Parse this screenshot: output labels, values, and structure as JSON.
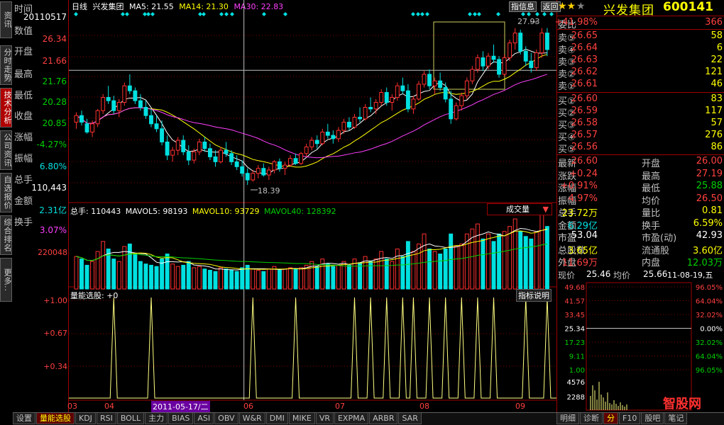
{
  "left_tabs": [
    "资讯",
    "分时走势",
    "技术分析",
    "公司资讯",
    "自选报价",
    "综合排名",
    "更多.."
  ],
  "left_tabs_active": 2,
  "info_column": {
    "labels": [
      "时间",
      "数值",
      "开盘",
      "最高",
      "最低",
      "收盘",
      "涨幅",
      "振幅",
      "总手",
      "金额",
      "换手"
    ],
    "time": "20110517",
    "value": "26.34",
    "open": "21.66",
    "high": "21.76",
    "low": "20.28",
    "close": "20.85",
    "change": "-4.27%",
    "amplitude": "6.80%",
    "volume": "110,443",
    "amount": "2.31亿",
    "turnover": "3.07%"
  },
  "header": {
    "period": "日线",
    "name": "兴发集团",
    "ma5": "MA5: 21.55",
    "ma14": "MA14: 21.30",
    "ma30": "MA30: 22.83",
    "btn_info": "信息",
    "btn_info_icon_label": "指",
    "btn_back": "返回"
  },
  "price_chart": {
    "ymin": 17.5,
    "ymax": 29.0,
    "high_label": "27.93",
    "low_label": "18.39",
    "ref_price": 25.34,
    "candles": [
      [
        22.2,
        22.8,
        21.8,
        22.6
      ],
      [
        22.6,
        22.9,
        22.0,
        22.2
      ],
      [
        22.1,
        22.4,
        21.5,
        21.6
      ],
      [
        21.6,
        22.3,
        21.3,
        22.1
      ],
      [
        22.1,
        23.0,
        21.9,
        22.9
      ],
      [
        22.9,
        23.9,
        22.7,
        23.7
      ],
      [
        23.7,
        24.4,
        23.3,
        23.5
      ],
      [
        23.5,
        23.8,
        22.7,
        22.9
      ],
      [
        22.9,
        23.6,
        22.5,
        23.4
      ],
      [
        23.4,
        24.6,
        23.2,
        24.4
      ],
      [
        24.4,
        25.1,
        23.9,
        24.1
      ],
      [
        24.1,
        24.3,
        23.3,
        23.5
      ],
      [
        23.5,
        23.9,
        22.9,
        23.1
      ],
      [
        23.1,
        23.5,
        22.4,
        22.6
      ],
      [
        22.6,
        23.0,
        21.9,
        22.1
      ],
      [
        22.1,
        22.6,
        21.6,
        21.8
      ],
      [
        21.8,
        22.3,
        20.8,
        21.0
      ],
      [
        21.0,
        21.4,
        19.9,
        20.2
      ],
      [
        20.2,
        20.7,
        19.8,
        20.5
      ],
      [
        20.5,
        21.3,
        20.2,
        21.1
      ],
      [
        21.1,
        21.4,
        20.2,
        20.4
      ],
      [
        20.4,
        20.8,
        19.6,
        19.9
      ],
      [
        19.9,
        20.6,
        19.7,
        20.4
      ],
      [
        20.4,
        21.2,
        20.2,
        21.0
      ],
      [
        21.0,
        21.3,
        20.4,
        20.6
      ],
      [
        20.6,
        20.9,
        19.9,
        20.1
      ],
      [
        20.1,
        20.5,
        19.5,
        19.8
      ],
      [
        19.8,
        20.7,
        19.7,
        20.5
      ],
      [
        20.5,
        21.0,
        20.1,
        20.3
      ],
      [
        20.3,
        20.5,
        19.6,
        19.8
      ],
      [
        19.8,
        20.2,
        19.3,
        19.5
      ],
      [
        19.5,
        19.9,
        18.9,
        19.1
      ],
      [
        19.1,
        19.4,
        18.4,
        18.7
      ],
      [
        18.7,
        19.3,
        18.6,
        19.1
      ],
      [
        19.1,
        19.6,
        18.8,
        19.4
      ],
      [
        19.4,
        19.7,
        18.9,
        19.0
      ],
      [
        19.0,
        19.5,
        18.7,
        19.3
      ],
      [
        19.3,
        19.9,
        19.1,
        19.8
      ],
      [
        19.8,
        20.0,
        19.2,
        19.4
      ],
      [
        19.4,
        19.8,
        19.0,
        19.6
      ],
      [
        19.6,
        20.2,
        19.5,
        20.0
      ],
      [
        20.0,
        20.3,
        19.6,
        19.7
      ],
      [
        19.7,
        20.4,
        19.6,
        20.3
      ],
      [
        20.3,
        20.9,
        20.1,
        20.7
      ],
      [
        20.7,
        21.3,
        20.5,
        21.1
      ],
      [
        21.1,
        21.4,
        20.6,
        20.9
      ],
      [
        20.9,
        21.8,
        20.8,
        21.6
      ],
      [
        21.6,
        22.1,
        21.2,
        21.4
      ],
      [
        21.4,
        21.7,
        20.9,
        21.2
      ],
      [
        21.2,
        21.9,
        21.0,
        21.7
      ],
      [
        21.7,
        22.4,
        21.5,
        22.2
      ],
      [
        22.2,
        22.5,
        21.7,
        21.9
      ],
      [
        21.9,
        22.7,
        21.8,
        22.5
      ],
      [
        22.5,
        23.1,
        22.2,
        22.4
      ],
      [
        22.4,
        23.3,
        22.3,
        23.1
      ],
      [
        23.1,
        23.7,
        22.8,
        23.0
      ],
      [
        23.0,
        23.6,
        22.7,
        23.4
      ],
      [
        23.4,
        24.2,
        23.2,
        24.0
      ],
      [
        24.0,
        24.3,
        23.2,
        23.4
      ],
      [
        23.4,
        23.9,
        22.9,
        23.7
      ],
      [
        23.7,
        24.6,
        23.5,
        24.4
      ],
      [
        24.4,
        24.9,
        23.9,
        24.1
      ],
      [
        24.1,
        24.5,
        22.8,
        23.0
      ],
      [
        23.0,
        23.8,
        22.7,
        23.6
      ],
      [
        23.6,
        24.7,
        23.5,
        24.5
      ],
      [
        24.5,
        25.3,
        24.3,
        25.1
      ],
      [
        25.1,
        25.4,
        24.2,
        24.4
      ],
      [
        24.4,
        24.9,
        23.9,
        24.7
      ],
      [
        24.7,
        25.2,
        24.1,
        24.3
      ],
      [
        24.3,
        24.6,
        23.4,
        23.6
      ],
      [
        23.6,
        24.1,
        22.1,
        22.4
      ],
      [
        22.4,
        23.4,
        22.3,
        23.2
      ],
      [
        23.2,
        24.0,
        22.9,
        23.8
      ],
      [
        23.8,
        24.9,
        23.6,
        24.7
      ],
      [
        24.7,
        25.6,
        24.5,
        25.4
      ],
      [
        25.4,
        26.3,
        25.2,
        26.1
      ],
      [
        26.1,
        26.5,
        25.3,
        25.6
      ],
      [
        25.6,
        26.4,
        25.4,
        26.2
      ],
      [
        26.2,
        26.9,
        25.8,
        26.0
      ],
      [
        26.0,
        26.2,
        24.9,
        25.1
      ],
      [
        25.1,
        26.3,
        25.0,
        26.1
      ],
      [
        26.1,
        27.2,
        25.9,
        27.0
      ],
      [
        27.0,
        27.9,
        26.6,
        27.6
      ],
      [
        27.6,
        27.8,
        26.3,
        26.5
      ],
      [
        26.5,
        26.8,
        25.6,
        25.9
      ],
      [
        25.9,
        26.4,
        25.2,
        25.5
      ],
      [
        25.5,
        26.6,
        25.3,
        26.4
      ],
      [
        26.4,
        27.9,
        26.1,
        27.6
      ],
      [
        27.6,
        27.9,
        26.2,
        26.6
      ]
    ]
  },
  "volume_panel": {
    "title": "总手: 110443",
    "mavol5": "MAVOL5: 98193",
    "mavol10": "MAVOL10: 93729",
    "mavol40": "MAVOL40: 128392",
    "dropdown": "成交量",
    "scale_label": "220048",
    "ymax": 300000,
    "values": [
      130000,
      120000,
      95000,
      110000,
      150000,
      190000,
      160000,
      120000,
      110000,
      170000,
      180000,
      140000,
      110000,
      100000,
      95000,
      90000,
      120000,
      140000,
      100000,
      90000,
      95000,
      110000,
      85000,
      90000,
      80000,
      75000,
      70000,
      85000,
      80000,
      75000,
      70000,
      85000,
      95000,
      80000,
      75000,
      70000,
      80000,
      90000,
      75000,
      80000,
      85000,
      80000,
      85000,
      95000,
      110000,
      90000,
      120000,
      100000,
      90000,
      95000,
      110000,
      95000,
      120000,
      105000,
      130000,
      110000,
      120000,
      150000,
      120000,
      110000,
      160000,
      130000,
      190000,
      150000,
      180000,
      220000,
      160000,
      150000,
      140000,
      160000,
      220000,
      170000,
      180000,
      220000,
      240000,
      260000,
      200000,
      220000,
      190000,
      220000,
      230000,
      250000,
      280000,
      230000,
      210000,
      200000,
      230000,
      300000,
      250000
    ]
  },
  "indicator_panel": {
    "title": "量能选股: +0",
    "btn_help": "指标说明",
    "ylabels": [
      "+1.00",
      "+0.67",
      "+0.34"
    ],
    "spikes": [
      7,
      14,
      33,
      41,
      52,
      55,
      58,
      61,
      63,
      66,
      69,
      72,
      75,
      78,
      84,
      88
    ]
  },
  "x_axis": {
    "labels": [
      "03",
      "04",
      "05",
      "06",
      "07",
      "08",
      "09"
    ],
    "cursor_date": "2011-05-17/二"
  },
  "right_panel": {
    "name": "兴发集团",
    "code": "600141",
    "weibi_label": "委比",
    "weibi_value": "+41.98%",
    "weibi_diff": "366",
    "asks": [
      {
        "label": "卖⑤",
        "price": "26.65",
        "vol": "58"
      },
      {
        "label": "卖④",
        "price": "26.64",
        "vol": "6"
      },
      {
        "label": "卖③",
        "price": "26.63",
        "vol": "22"
      },
      {
        "label": "卖②",
        "price": "26.62",
        "vol": "121"
      },
      {
        "label": "卖①",
        "price": "26.61",
        "vol": "46"
      }
    ],
    "bids": [
      {
        "label": "买①",
        "price": "26.60",
        "vol": "83"
      },
      {
        "label": "买②",
        "price": "26.59",
        "vol": "117"
      },
      {
        "label": "买③",
        "price": "26.58",
        "vol": "57"
      },
      {
        "label": "买④",
        "price": "26.57",
        "vol": "276"
      },
      {
        "label": "买⑤",
        "price": "26.56",
        "vol": "86"
      }
    ],
    "stats": [
      {
        "k": "最新",
        "v": "26.60",
        "k2": "开盘",
        "v2": "26.00",
        "c1": "red",
        "c2": "red"
      },
      {
        "k": "涨跌",
        "v": "+0.24",
        "k2": "最高",
        "v2": "27.19",
        "c1": "red",
        "c2": "red"
      },
      {
        "k": "涨幅",
        "v": "+0.91%",
        "k2": "最低",
        "v2": "25.88",
        "c1": "red",
        "c2": "grn"
      },
      {
        "k": "振幅",
        "v": "4.97%",
        "k2": "均价",
        "v2": "26.50",
        "c1": "red",
        "c2": "red"
      },
      {
        "k": "总手",
        "v": "23.72万",
        "k2": "量比",
        "v2": "0.81",
        "c1": "yel",
        "c2": "yel"
      },
      {
        "k": "金额",
        "v": "6.29亿",
        "k2": "换手",
        "v2": "6.59%",
        "c1": "cyan",
        "c2": "yel"
      },
      {
        "k": "市盈",
        "v": "53.04",
        "k2": "市盈(动)",
        "v2": "42.93",
        "c1": "wht",
        "c2": "wht"
      },
      {
        "k": "总股数",
        "v": "3.65亿",
        "k2": "流通股",
        "v2": "3.60亿",
        "c1": "yel",
        "c2": "yel"
      },
      {
        "k": "外盘",
        "v": "11.69万",
        "k2": "内盘",
        "v2": "12.03万",
        "c1": "red",
        "c2": "grn"
      }
    ],
    "current_label": "现价",
    "current_value": "25.46",
    "avg_label": "均价",
    "avg_value": "25.66",
    "date_value": "11-08-19,五",
    "mini_left": [
      "49.68",
      "41.57",
      "33.45",
      "25.34",
      "17.23",
      "9.11",
      "1.00"
    ],
    "mini_right": [
      "96.05%",
      "64.04%",
      "32.02%",
      "0.00%",
      "32.02%",
      "64.04%",
      "96.05%"
    ],
    "mini_vol": [
      "4576",
      "2288"
    ],
    "tabs": [
      "明细",
      "诊断",
      "分",
      "F10",
      "股吧",
      "笔记"
    ],
    "watermark": "智股网"
  },
  "bottom_tabs": [
    "设置",
    "量能选股",
    "KDJ",
    "RSI",
    "BOLL",
    "主力",
    "BIAS",
    "ASI",
    "OBV",
    "W&R",
    "DMI",
    "MIKE",
    "VR",
    "EXPMA",
    "ARBR",
    "SAR"
  ],
  "bottom_tabs_active": 1
}
